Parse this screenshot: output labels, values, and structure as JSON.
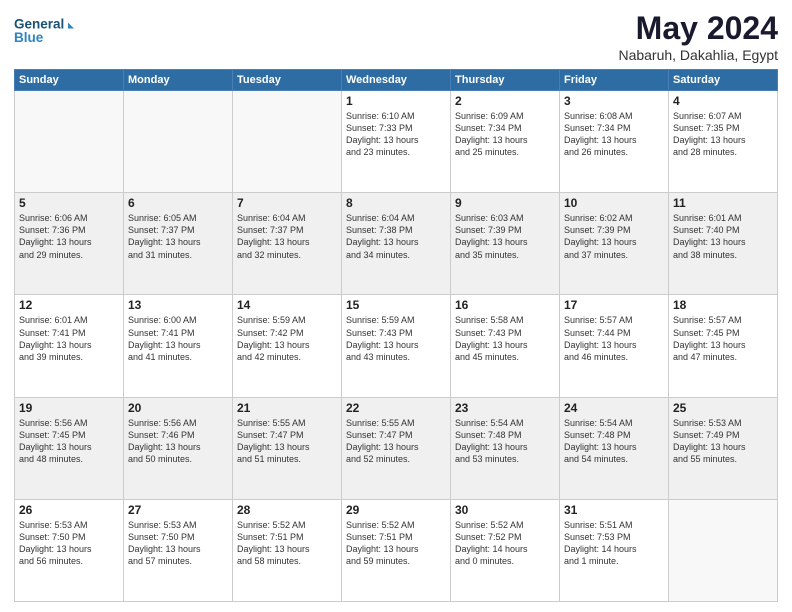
{
  "logo": {
    "line1": "General",
    "line2": "Blue"
  },
  "header": {
    "month": "May 2024",
    "location": "Nabaruh, Dakahlia, Egypt"
  },
  "weekdays": [
    "Sunday",
    "Monday",
    "Tuesday",
    "Wednesday",
    "Thursday",
    "Friday",
    "Saturday"
  ],
  "weeks": [
    [
      {
        "day": "",
        "info": ""
      },
      {
        "day": "",
        "info": ""
      },
      {
        "day": "",
        "info": ""
      },
      {
        "day": "1",
        "info": "Sunrise: 6:10 AM\nSunset: 7:33 PM\nDaylight: 13 hours\nand 23 minutes."
      },
      {
        "day": "2",
        "info": "Sunrise: 6:09 AM\nSunset: 7:34 PM\nDaylight: 13 hours\nand 25 minutes."
      },
      {
        "day": "3",
        "info": "Sunrise: 6:08 AM\nSunset: 7:34 PM\nDaylight: 13 hours\nand 26 minutes."
      },
      {
        "day": "4",
        "info": "Sunrise: 6:07 AM\nSunset: 7:35 PM\nDaylight: 13 hours\nand 28 minutes."
      }
    ],
    [
      {
        "day": "5",
        "info": "Sunrise: 6:06 AM\nSunset: 7:36 PM\nDaylight: 13 hours\nand 29 minutes."
      },
      {
        "day": "6",
        "info": "Sunrise: 6:05 AM\nSunset: 7:37 PM\nDaylight: 13 hours\nand 31 minutes."
      },
      {
        "day": "7",
        "info": "Sunrise: 6:04 AM\nSunset: 7:37 PM\nDaylight: 13 hours\nand 32 minutes."
      },
      {
        "day": "8",
        "info": "Sunrise: 6:04 AM\nSunset: 7:38 PM\nDaylight: 13 hours\nand 34 minutes."
      },
      {
        "day": "9",
        "info": "Sunrise: 6:03 AM\nSunset: 7:39 PM\nDaylight: 13 hours\nand 35 minutes."
      },
      {
        "day": "10",
        "info": "Sunrise: 6:02 AM\nSunset: 7:39 PM\nDaylight: 13 hours\nand 37 minutes."
      },
      {
        "day": "11",
        "info": "Sunrise: 6:01 AM\nSunset: 7:40 PM\nDaylight: 13 hours\nand 38 minutes."
      }
    ],
    [
      {
        "day": "12",
        "info": "Sunrise: 6:01 AM\nSunset: 7:41 PM\nDaylight: 13 hours\nand 39 minutes."
      },
      {
        "day": "13",
        "info": "Sunrise: 6:00 AM\nSunset: 7:41 PM\nDaylight: 13 hours\nand 41 minutes."
      },
      {
        "day": "14",
        "info": "Sunrise: 5:59 AM\nSunset: 7:42 PM\nDaylight: 13 hours\nand 42 minutes."
      },
      {
        "day": "15",
        "info": "Sunrise: 5:59 AM\nSunset: 7:43 PM\nDaylight: 13 hours\nand 43 minutes."
      },
      {
        "day": "16",
        "info": "Sunrise: 5:58 AM\nSunset: 7:43 PM\nDaylight: 13 hours\nand 45 minutes."
      },
      {
        "day": "17",
        "info": "Sunrise: 5:57 AM\nSunset: 7:44 PM\nDaylight: 13 hours\nand 46 minutes."
      },
      {
        "day": "18",
        "info": "Sunrise: 5:57 AM\nSunset: 7:45 PM\nDaylight: 13 hours\nand 47 minutes."
      }
    ],
    [
      {
        "day": "19",
        "info": "Sunrise: 5:56 AM\nSunset: 7:45 PM\nDaylight: 13 hours\nand 48 minutes."
      },
      {
        "day": "20",
        "info": "Sunrise: 5:56 AM\nSunset: 7:46 PM\nDaylight: 13 hours\nand 50 minutes."
      },
      {
        "day": "21",
        "info": "Sunrise: 5:55 AM\nSunset: 7:47 PM\nDaylight: 13 hours\nand 51 minutes."
      },
      {
        "day": "22",
        "info": "Sunrise: 5:55 AM\nSunset: 7:47 PM\nDaylight: 13 hours\nand 52 minutes."
      },
      {
        "day": "23",
        "info": "Sunrise: 5:54 AM\nSunset: 7:48 PM\nDaylight: 13 hours\nand 53 minutes."
      },
      {
        "day": "24",
        "info": "Sunrise: 5:54 AM\nSunset: 7:48 PM\nDaylight: 13 hours\nand 54 minutes."
      },
      {
        "day": "25",
        "info": "Sunrise: 5:53 AM\nSunset: 7:49 PM\nDaylight: 13 hours\nand 55 minutes."
      }
    ],
    [
      {
        "day": "26",
        "info": "Sunrise: 5:53 AM\nSunset: 7:50 PM\nDaylight: 13 hours\nand 56 minutes."
      },
      {
        "day": "27",
        "info": "Sunrise: 5:53 AM\nSunset: 7:50 PM\nDaylight: 13 hours\nand 57 minutes."
      },
      {
        "day": "28",
        "info": "Sunrise: 5:52 AM\nSunset: 7:51 PM\nDaylight: 13 hours\nand 58 minutes."
      },
      {
        "day": "29",
        "info": "Sunrise: 5:52 AM\nSunset: 7:51 PM\nDaylight: 13 hours\nand 59 minutes."
      },
      {
        "day": "30",
        "info": "Sunrise: 5:52 AM\nSunset: 7:52 PM\nDaylight: 14 hours\nand 0 minutes."
      },
      {
        "day": "31",
        "info": "Sunrise: 5:51 AM\nSunset: 7:53 PM\nDaylight: 14 hours\nand 1 minute."
      },
      {
        "day": "",
        "info": ""
      }
    ]
  ]
}
